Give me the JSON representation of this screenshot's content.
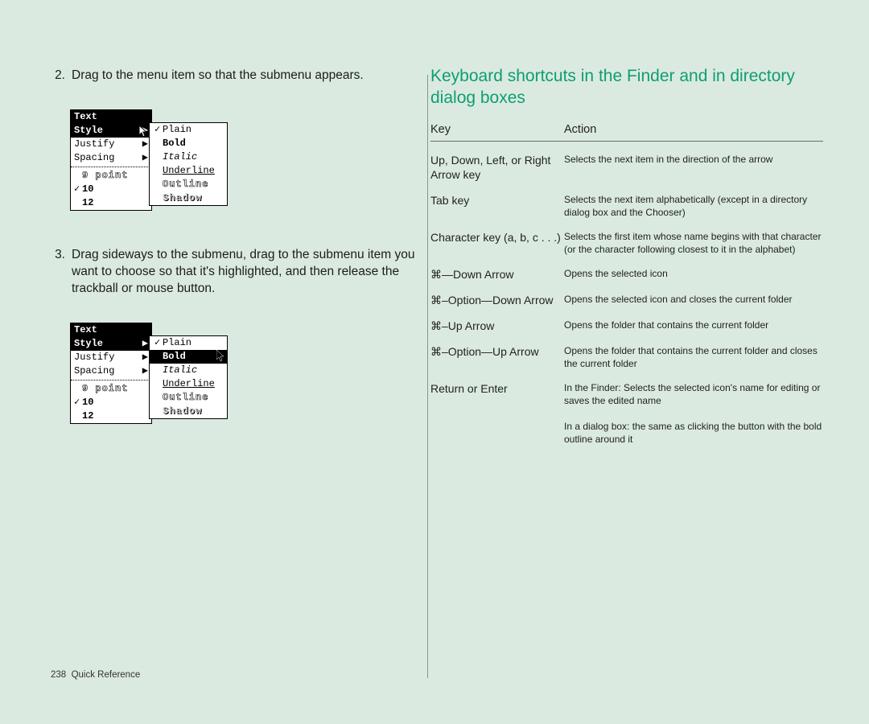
{
  "left": {
    "step2_num": "2.",
    "step2_text": "Drag to the menu item so that the submenu appears.",
    "step3_num": "3.",
    "step3_text": "Drag sideways to the submenu, drag to the submenu item you want to choose so that it's highlighted, and then release the trackball or mouse button.",
    "menu": {
      "title": "Text",
      "items": [
        "Style",
        "Justify",
        "Spacing"
      ],
      "sizes": [
        "9 point",
        "10",
        "12"
      ],
      "checked_size": "10",
      "submenu": [
        "Plain",
        "Bold",
        "Italic",
        "Underline",
        "Outline",
        "Shadow"
      ],
      "submenu_checked": "Plain",
      "submenu_highlight_b": "Bold"
    }
  },
  "right": {
    "title": "Keyboard shortcuts in the Finder and in directory dialog boxes",
    "head_key": "Key",
    "head_action": "Action",
    "rows": [
      {
        "k": "Up, Down, Left, or Right Arrow key",
        "a": "Selects the next item in the direction of the arrow"
      },
      {
        "k": "Tab key",
        "a": "Selects the next item alphabetically (except in a directory dialog box and the Chooser)"
      },
      {
        "k": "Character key (a, b, c . . .)",
        "a": "Selects the first item whose name begins with that character (or the character following closest to it in the alphabet)"
      },
      {
        "k": "⌘—Down Arrow",
        "a": "Opens the selected icon"
      },
      {
        "k": "⌘–Option—Down Arrow",
        "a": "Opens the selected icon and closes the current folder"
      },
      {
        "k": "⌘–Up Arrow",
        "a": "Opens the folder that contains the current folder"
      },
      {
        "k": "⌘–Option—Up Arrow",
        "a": "Opens the folder that contains the current folder and closes the current folder"
      },
      {
        "k": "Return or Enter",
        "a": "In the Finder: Selects the selected icon's name for editing or saves the edited name<br><br>In a dialog box: the same as clicking the button with the bold outline around it"
      }
    ]
  },
  "footer": {
    "page": "238",
    "label": "Quick Reference"
  }
}
